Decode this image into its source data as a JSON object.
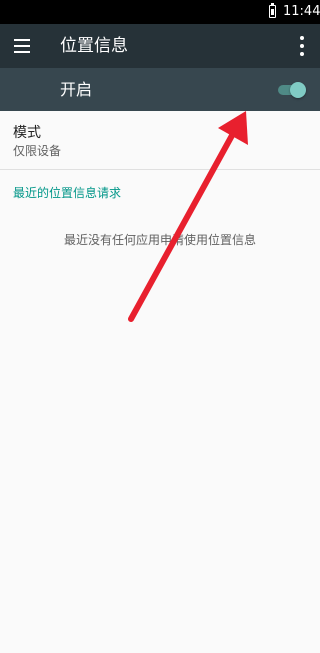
{
  "status_bar": {
    "time": "11:44",
    "battery_icon": "battery-icon"
  },
  "toolbar": {
    "menu_icon": "menu-icon",
    "title": "位置信息",
    "overflow_icon": "more-vert-icon"
  },
  "master_switch": {
    "label": "开启",
    "on": true,
    "accent_color": "#80cbc4"
  },
  "mode": {
    "title": "模式",
    "value": "仅限设备"
  },
  "recent_requests": {
    "header": "最近的位置信息请求",
    "empty_message": "最近没有任何应用申请使用位置信息"
  },
  "annotation": {
    "arrow_color": "#e8202e"
  },
  "colors": {
    "toolbar": "#263238",
    "switch_bar": "#37474f",
    "accent": "#009688",
    "background": "#fafafa"
  }
}
